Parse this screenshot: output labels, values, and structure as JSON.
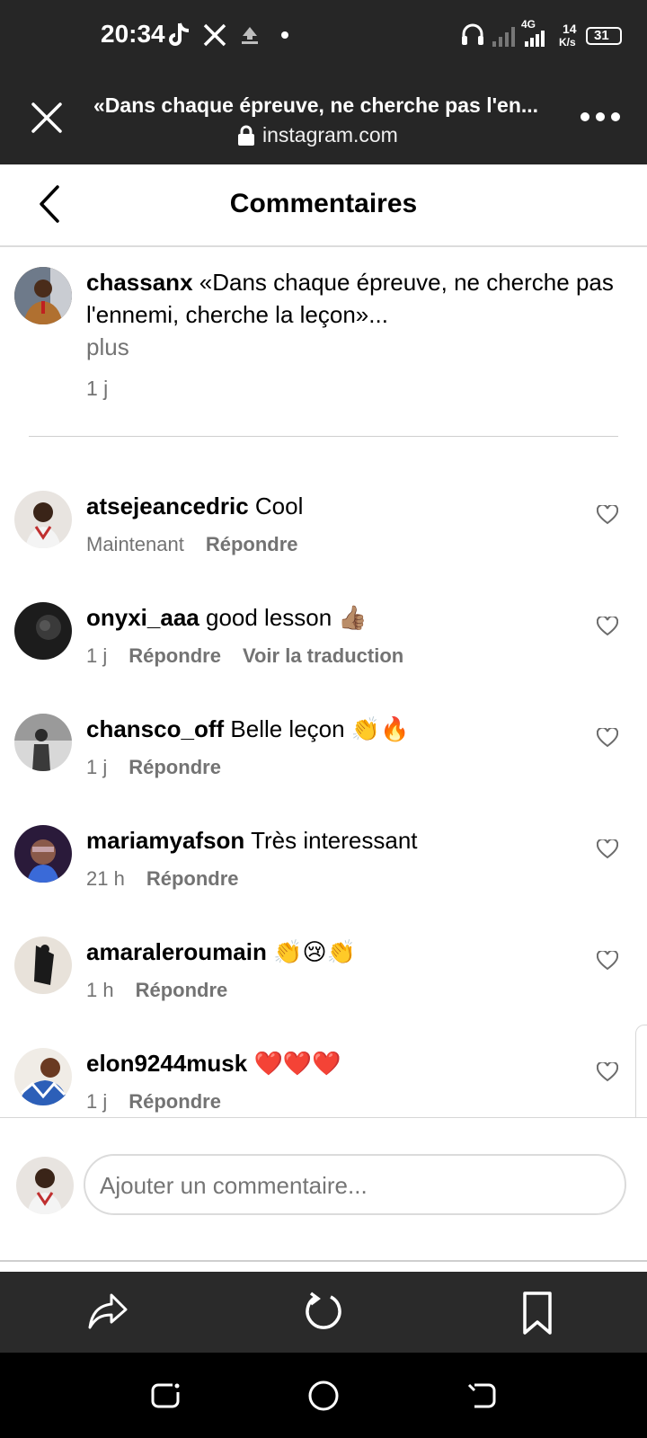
{
  "status_bar": {
    "time": "20:34",
    "network": "4G",
    "speed": "14",
    "speed_unit": "K/s",
    "battery": "31"
  },
  "browser": {
    "page_title": "«Dans chaque épreuve, ne cherche pas l'en...",
    "url": "instagram.com"
  },
  "header": {
    "title": "Commentaires"
  },
  "caption": {
    "username": "chassanx",
    "text": "«Dans chaque épreuve, ne cherche pas l'ennemi, cherche la leçon»...",
    "more_label": "plus",
    "time": "1 j"
  },
  "comments": [
    {
      "username": "atsejeancedric",
      "text": "Cool",
      "time": "Maintenant",
      "reply_label": "Répondre",
      "translate_label": ""
    },
    {
      "username": "onyxi_aaa",
      "text": "good lesson 👍🏽",
      "time": "1 j",
      "reply_label": "Répondre",
      "translate_label": "Voir la traduction"
    },
    {
      "username": "chansco_off",
      "text": "Belle leçon 👏🔥",
      "time": "1 j",
      "reply_label": "Répondre",
      "translate_label": ""
    },
    {
      "username": "mariamyafson",
      "text": "Très interessant",
      "time": "21 h",
      "reply_label": "Répondre",
      "translate_label": ""
    },
    {
      "username": "amaraleroumain",
      "text": "👏😢👏",
      "time": "1 h",
      "reply_label": "Répondre",
      "translate_label": ""
    },
    {
      "username": "elon9244musk",
      "text": "❤️❤️❤️",
      "time": "1 j",
      "reply_label": "Répondre",
      "translate_label": ""
    }
  ],
  "composer": {
    "placeholder": "Ajouter un commentaire..."
  },
  "icons": {
    "close": "close-icon",
    "menu": "more-icon",
    "back": "back-arrow-icon",
    "like": "heart-icon",
    "share": "share-icon",
    "reload": "reload-icon",
    "bookmark": "bookmark-icon"
  },
  "colors": {
    "bar_background": "#262626",
    "secondary_text": "#737373",
    "divider": "#dcdcdc"
  }
}
